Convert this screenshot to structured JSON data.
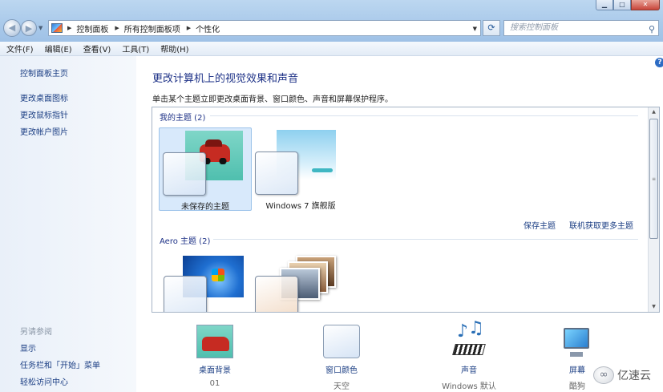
{
  "address": {
    "crumbs": [
      "控制面板",
      "所有控制面板项",
      "个性化"
    ],
    "search_placeholder": "搜索控制面板"
  },
  "menu": [
    "文件(F)",
    "编辑(E)",
    "查看(V)",
    "工具(T)",
    "帮助(H)"
  ],
  "left_pane": {
    "links": [
      "控制面板主页",
      "更改桌面图标",
      "更改鼠标指针",
      "更改帐户图片"
    ],
    "see_also_title": "另请参阅",
    "see_also": [
      "显示",
      "任务栏和「开始」菜单",
      "轻松访问中心"
    ]
  },
  "main": {
    "title": "更改计算机上的视觉效果和声音",
    "subtitle": "单击某个主题立即更改桌面背景、窗口颜色、声音和屏幕保护程序。",
    "my_themes_header": "我的主题 (2)",
    "my_themes": [
      "未保存的主题",
      "Windows 7 旗舰版"
    ],
    "save_theme": "保存主题",
    "get_more": "联机获取更多主题",
    "aero_header": "Aero 主题 (2)"
  },
  "settings": [
    {
      "name": "桌面背景",
      "value": "01"
    },
    {
      "name": "窗口颜色",
      "value": "天空"
    },
    {
      "name": "声音",
      "value": "Windows 默认"
    },
    {
      "name": "屏幕",
      "value": "酷狗"
    }
  ],
  "watermark": "亿速云"
}
